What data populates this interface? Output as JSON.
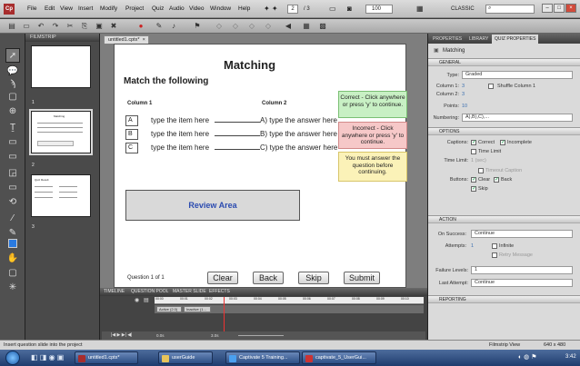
{
  "menubar": {
    "logo": "Cp",
    "items": [
      "File",
      "Edit",
      "View",
      "Insert",
      "Modify",
      "Project",
      "Quiz",
      "Audio",
      "Video",
      "Window",
      "Help"
    ],
    "slide_current": "2",
    "slide_total": "/ 3",
    "zoom": "100",
    "workspace": "CLASSIC",
    "search_placeholder": ""
  },
  "filmstrip": {
    "title": "FILMSTRIP",
    "slides": [
      {
        "num": "1"
      },
      {
        "num": "2",
        "mini_title": "Matching"
      },
      {
        "num": "3",
        "mini_title": "Quiz Result"
      }
    ]
  },
  "document": {
    "tab": "untitled1.cptx*"
  },
  "slide": {
    "heading": "Matching",
    "instruction": "Match the following",
    "col1": "Column 1",
    "col2": "Column 2",
    "rows": [
      {
        "key": "A",
        "item": "type the item here",
        "answer": "A) type the answer here"
      },
      {
        "key": "B",
        "item": "type the item here",
        "answer": "B) type the answer here"
      },
      {
        "key": "C",
        "item": "type the item here",
        "answer": "C) type the answer here"
      }
    ],
    "captions": {
      "correct": "Correct - Click anywhere or press 'y' to continue.",
      "incorrect": "Incorrect - Click anywhere or press 'y' to continue.",
      "must_answer": "You must answer the question before continuing."
    },
    "review_area": "Review Area",
    "question_counter": "Question 1 of 1",
    "buttons": {
      "clear": "Clear",
      "back": "Back",
      "skip": "Skip",
      "submit": "Submit"
    }
  },
  "timeline": {
    "tabs": [
      "TIMELINE",
      "QUESTION POOL",
      "MASTER SLIDE",
      "EFFECTS"
    ],
    "ticks": [
      "00:00",
      "00:01",
      "00:02",
      "00:03",
      "00:04",
      "00:05",
      "00:06",
      "00:07",
      "00:08",
      "00:09",
      "00:10"
    ],
    "bar1": "Active (2.0)",
    "bar2": "Inactive (1...",
    "time_a": "0.0s",
    "time_b": "3.0s"
  },
  "properties": {
    "tabs": [
      "PROPERTIES",
      "LIBRARY",
      "QUIZ PROPERTIES"
    ],
    "title": "Matching",
    "general": {
      "heading": "GENERAL",
      "type_label": "Type:",
      "type_value": "Graded",
      "column1_label": "Column 1:",
      "column1_value": "3",
      "column2_label": "Column 2:",
      "column2_value": "3",
      "shuffle": "Shuffle Column 1",
      "points_label": "Points:",
      "points_value": "10",
      "numbering_label": "Numbering:",
      "numbering_value": "A),B),C),..."
    },
    "options": {
      "heading": "OPTIONS",
      "captions_label": "Captions:",
      "correct": "Correct",
      "incorrect": "Incomplete",
      "time_limit": "Time Limit",
      "time_limit_label": "Time Limit:",
      "time_limit_value": "1 (sec)",
      "timeout_caption": "Timeout Caption",
      "buttons_label": "Buttons:",
      "clear": "Clear",
      "back": "Back",
      "skip": "Skip"
    },
    "action": {
      "heading": "ACTION",
      "on_success_label": "On Success:",
      "on_success_value": "Continue",
      "attempts_label": "Attempts:",
      "attempts_value": "1",
      "infinite": "Infinite",
      "retry": "Retry Message",
      "failure_label": "Failure Levels:",
      "failure_value": "1",
      "last_label": "Last Attempt:",
      "last_value": "Continue"
    },
    "reporting": {
      "heading": "REPORTING"
    }
  },
  "statusbar": {
    "left": "Insert question slide into the project",
    "view": "Filmstrip View",
    "size": "640 x 480"
  },
  "taskbar": {
    "tasks": [
      "untitled1.cptx*",
      "userGuide",
      "Captivate 5 Training...",
      "captivate_5_UserGui..."
    ],
    "clock": "3:42"
  }
}
